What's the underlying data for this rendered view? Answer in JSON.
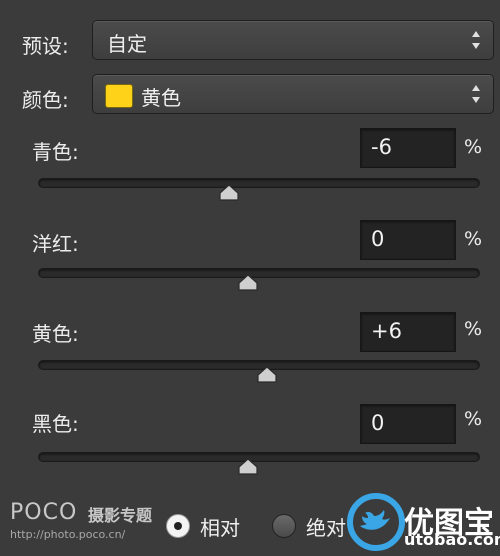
{
  "preset": {
    "label": "预设:",
    "value": "自定"
  },
  "colors": {
    "label": "颜色:",
    "value": "黄色",
    "swatch_color": "#ffd21a"
  },
  "sliders": [
    {
      "label": "青色:",
      "value": "-6",
      "unit": "%",
      "position": -6
    },
    {
      "label": "洋红:",
      "value": "0",
      "unit": "%",
      "position": 0
    },
    {
      "label": "黄色:",
      "value": "+6",
      "unit": "%",
      "position": 6
    },
    {
      "label": "黑色:",
      "value": "0",
      "unit": "%",
      "position": 0
    }
  ],
  "mode": {
    "relative_label": "相对",
    "absolute_label": "绝对",
    "selected": "relative"
  },
  "watermark": {
    "left_brand": "POCO",
    "left_sub": "摄影专题",
    "left_url": "http://photo.poco.cn/",
    "right_brand": "优图宝",
    "right_url": "utobao.com"
  },
  "icons": {
    "select_arrows": "updown-arrows-icon",
    "slider_thumb": "slider-thumb-icon",
    "bird": "bird-logo-icon"
  }
}
